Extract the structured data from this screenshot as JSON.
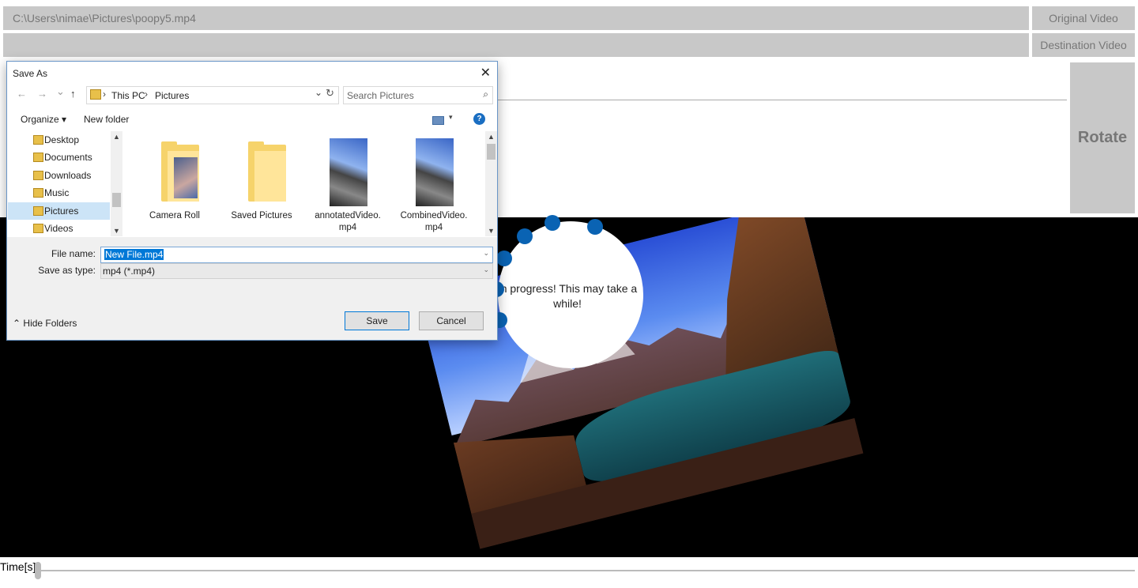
{
  "top": {
    "source_path": "C:\\Users\\nimae\\Pictures\\poopy5.mp4",
    "original_video_label": "Original Video",
    "destination_video_label": "Destination Video",
    "rotate_label": "Rotate"
  },
  "progress": {
    "message": "In progress! This may take a while!"
  },
  "timeline": {
    "label": "Time[s]"
  },
  "dialog": {
    "title": "Save As",
    "close_glyph": "✕",
    "nav": {
      "back_glyph": "←",
      "forward_glyph": "→",
      "recent_glyph": "⌄",
      "up_glyph": "↑",
      "breadcrumb": [
        "This PC",
        "Pictures"
      ],
      "chevron_glyph": "›",
      "dropdown_glyph": "⌄",
      "refresh_glyph": "↻",
      "search_placeholder": "Search Pictures",
      "search_glyph": "⌕"
    },
    "toolbar": {
      "organize_label": "Organize ▾",
      "new_folder_label": "New folder",
      "view_caret": "▾",
      "help_glyph": "?"
    },
    "nav_pane": {
      "items": [
        "Desktop",
        "Documents",
        "Downloads",
        "Music",
        "Pictures",
        "Videos"
      ],
      "selected": "Pictures",
      "scroll_up": "▲",
      "scroll_down": "▼"
    },
    "files": [
      {
        "name": "Camera Roll",
        "kind": "folder-photo"
      },
      {
        "name": "Saved Pictures",
        "kind": "folder"
      },
      {
        "name": "annotatedVideo.\nmp4",
        "kind": "video"
      },
      {
        "name": "CombinedVideo.\nmp4",
        "kind": "video"
      }
    ],
    "file_name_label": "File name:",
    "file_name_value": "New File.mp4",
    "save_as_type_label": "Save as type:",
    "save_as_type_value": "mp4 (*.mp4)",
    "combo_caret": "⌄",
    "hide_folders_label": "Hide Folders",
    "hide_folders_glyph": "⌃",
    "save_label": "Save",
    "cancel_label": "Cancel"
  }
}
